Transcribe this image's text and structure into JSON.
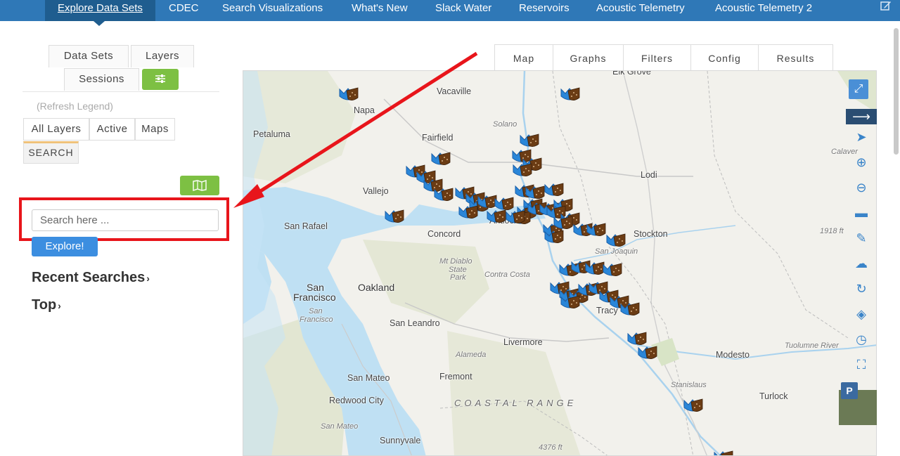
{
  "topnav": {
    "items": [
      "Explore Data Sets",
      "CDEC",
      "Search Visualizations",
      "What's New",
      "Slack Water",
      "Reservoirs",
      "Acoustic Telemetry",
      "Acoustic Telemetry 2"
    ],
    "active": "Explore Data Sets"
  },
  "sidebar": {
    "tabs": [
      "Data Sets",
      "Layers",
      "Sessions"
    ],
    "refresh_legend": "(Refresh Legend)",
    "layer_tabs": [
      "All Layers",
      "Active",
      "Maps"
    ],
    "search_tab": "SEARCH",
    "search": {
      "placeholder": "Search here ...",
      "value": ""
    },
    "explore_label": "Explore!",
    "recent_searches": "Recent Searches",
    "top": "Top"
  },
  "map_tabs": [
    "Map",
    "Graphs",
    "Filters",
    "Config",
    "Results"
  ],
  "map": {
    "places": {
      "elk_grove": "Elk Grove",
      "vacaville": "Vacaville",
      "napa": "Napa",
      "solano": "Solano",
      "petaluma": "Petaluma",
      "fairfield": "Fairfield",
      "lodi": "Lodi",
      "calaveras": "Calaver",
      "vallejo": "Vallejo",
      "san_rafael": "San Rafael",
      "concord": "Concord",
      "antioch": "Antioch",
      "stockton": "Stockton",
      "san_joaquin": "San Joaquin",
      "elev_1918": "1918 ft",
      "mt_diablo": "Mt Diablo",
      "state": "State",
      "park": "Park",
      "contra_costa": "Contra Costa",
      "san": "San",
      "francisco": "Francisco",
      "oakland": "Oakland",
      "san_light": "San",
      "francisco_light": "Francisco",
      "tracy": "Tracy",
      "san_leandro": "San Leandro",
      "livermore": "Livermore",
      "modesto": "Modesto",
      "tuolumne": "Tuolumne River",
      "alameda": "Alameda",
      "san_mateo": "San Mateo",
      "fremont": "Fremont",
      "stanislaus": "Stanislaus",
      "coastal_range": "COASTAL RANGE",
      "redwood_city": "Redwood City",
      "turlock": "Turlock",
      "san_mateo_light": "San Mateo",
      "sunnyvale": "Sunnyvale",
      "elev_4376": "4376 ft"
    }
  },
  "colors": {
    "nav": "#2f78b7",
    "nav_active": "#1f5d8f",
    "green": "#7dc043",
    "explore": "#3c8ee0",
    "highlight": "#e8151b",
    "water": "#bfe0f3"
  },
  "icons": [
    "edit-icon",
    "sliders-icon",
    "map-icon",
    "expand-icon",
    "arrow-right-icon",
    "pointer-icon",
    "zoom-in-icon",
    "zoom-out-icon",
    "ruler-icon",
    "pencil-icon",
    "upload-cloud-icon",
    "refresh-icon",
    "layers-icon",
    "clock-icon",
    "fullscreen-icon"
  ],
  "parking_badge": "P"
}
